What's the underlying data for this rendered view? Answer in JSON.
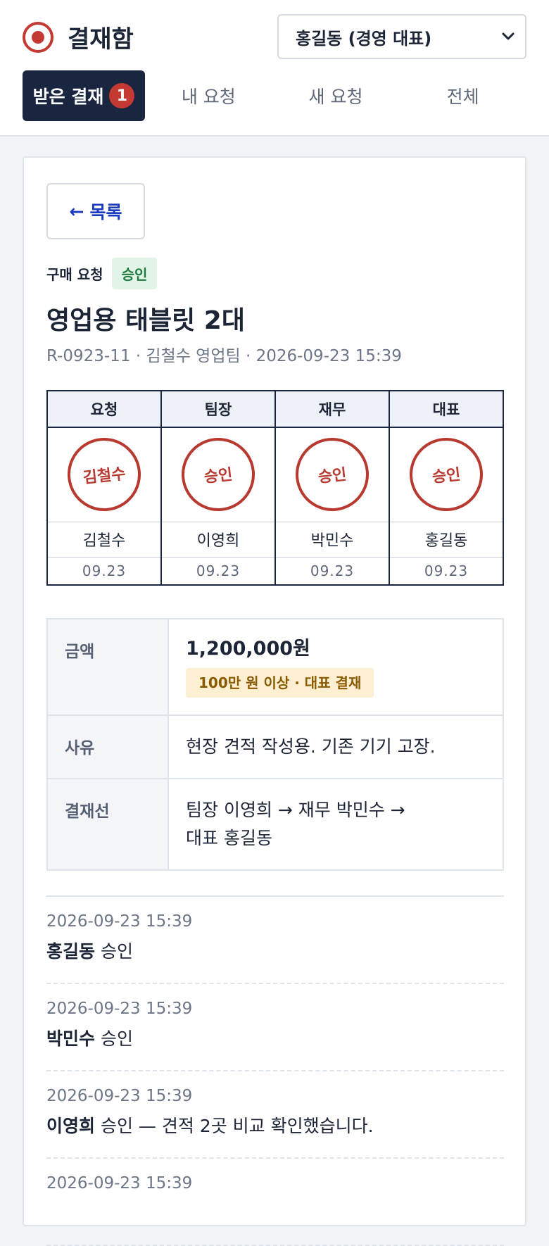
{
  "header": {
    "title": "결재함",
    "user_select": "홍길동 (경영 대표)",
    "tabs": [
      {
        "label": "받은 결재",
        "badge": "1"
      },
      {
        "label": "내 요청"
      },
      {
        "label": "새 요청"
      },
      {
        "label": "전체"
      }
    ]
  },
  "detail": {
    "back_label": "목록",
    "request_type": "구매 요청",
    "status": "승인",
    "title": "영업용 태블릿 2대",
    "meta": "R-0923-11 · 김철수 영업팀 · 2026-09-23 15:39",
    "stamps": [
      {
        "role": "요청",
        "stamp": "김철수",
        "name": "김철수",
        "date": "09.23"
      },
      {
        "role": "팀장",
        "stamp": "승인",
        "name": "이영희",
        "date": "09.23"
      },
      {
        "role": "재무",
        "stamp": "승인",
        "name": "박민수",
        "date": "09.23"
      },
      {
        "role": "대표",
        "stamp": "승인",
        "name": "홍길동",
        "date": "09.23"
      }
    ],
    "info": {
      "amount_label": "금액",
      "amount": "1,200,000원",
      "amount_note": "100만 원 이상 · 대표 결재",
      "reason_label": "사유",
      "reason": "현장 견적 작성용. 기존 기기 고장.",
      "line_label": "결재선",
      "line_1": "팀장 이영희 → 재무 박민수 →",
      "line_2": "대표 홍길동"
    },
    "history": [
      {
        "time": "2026-09-23 15:39",
        "name": "홍길동",
        "text": " 승인"
      },
      {
        "time": "2026-09-23 15:39",
        "name": "박민수",
        "text": " 승인"
      },
      {
        "time": "2026-09-23 15:39",
        "name": "이영희",
        "text": " 승인 — 견적 2곳 비교 확인했습니다."
      },
      {
        "time": "2026-09-23 15:39",
        "name": "",
        "text": ""
      }
    ]
  }
}
